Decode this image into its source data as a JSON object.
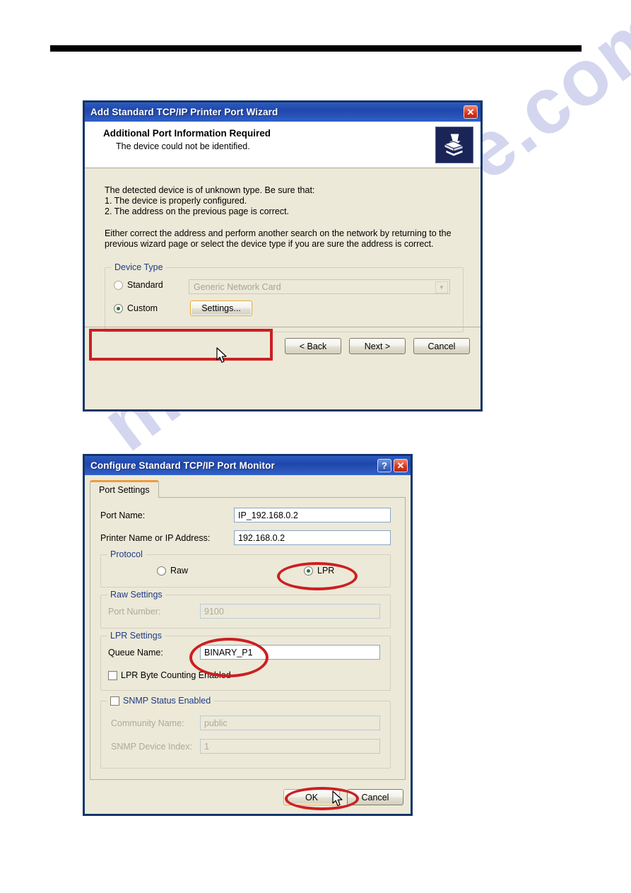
{
  "page": {
    "watermark_text": "manualshive.com",
    "header_rule": "black-bar"
  },
  "wizard_dialog": {
    "title": "Add Standard TCP/IP Printer Port Wizard",
    "close_label": "✕",
    "icon_name": "printer-icon",
    "heading": "Additional Port Information Required",
    "subheading": "The device could not be identified.",
    "body_paragraph_1": "The detected device is of unknown type.  Be sure that:\n1. The device is properly configured.\n2.  The address on the previous page is correct.",
    "body_paragraph_2": "Either correct the address and perform another search on the network by returning to the previous wizard page or select the device type if you are sure the address is correct.",
    "device_type_group": {
      "legend": "Device Type",
      "standard_label": "Standard",
      "standard_selected": false,
      "standard_combo_value": "Generic Network Card",
      "custom_label": "Custom",
      "custom_selected": true,
      "settings_button": "Settings..."
    },
    "buttons": {
      "back": "< Back",
      "next": "Next >",
      "cancel": "Cancel"
    }
  },
  "config_dialog": {
    "title": "Configure Standard TCP/IP Port Monitor",
    "help_label": "?",
    "close_label": "✕",
    "tab_label": "Port Settings",
    "port_name_label": "Port Name:",
    "port_name_value": "IP_192.168.0.2",
    "printer_name_label": "Printer Name or IP Address:",
    "printer_name_value": "192.168.0.2",
    "protocol": {
      "legend": "Protocol",
      "raw_label": "Raw",
      "raw_selected": false,
      "lpr_label": "LPR",
      "lpr_selected": true
    },
    "raw_settings": {
      "legend": "Raw Settings",
      "port_number_label": "Port Number:",
      "port_number_value": "9100"
    },
    "lpr_settings": {
      "legend": "LPR Settings",
      "queue_name_label": "Queue Name:",
      "queue_name_value": "BINARY_P1",
      "byte_counting_label": "LPR Byte Counting Enabled",
      "byte_counting_checked": false
    },
    "snmp": {
      "status_enabled_label": "SNMP Status Enabled",
      "status_enabled_checked": false,
      "community_name_label": "Community Name:",
      "community_name_value": "public",
      "device_index_label": "SNMP Device Index:",
      "device_index_value": "1"
    },
    "buttons": {
      "ok": "OK",
      "cancel": "Cancel"
    }
  },
  "annotations": {
    "accent_color": "#cc1f22",
    "custom_row_highlight": "rectangle",
    "lpr_radio_highlight": "ellipse",
    "queue_name_highlight": "ellipse",
    "ok_button_highlight": "ellipse"
  }
}
